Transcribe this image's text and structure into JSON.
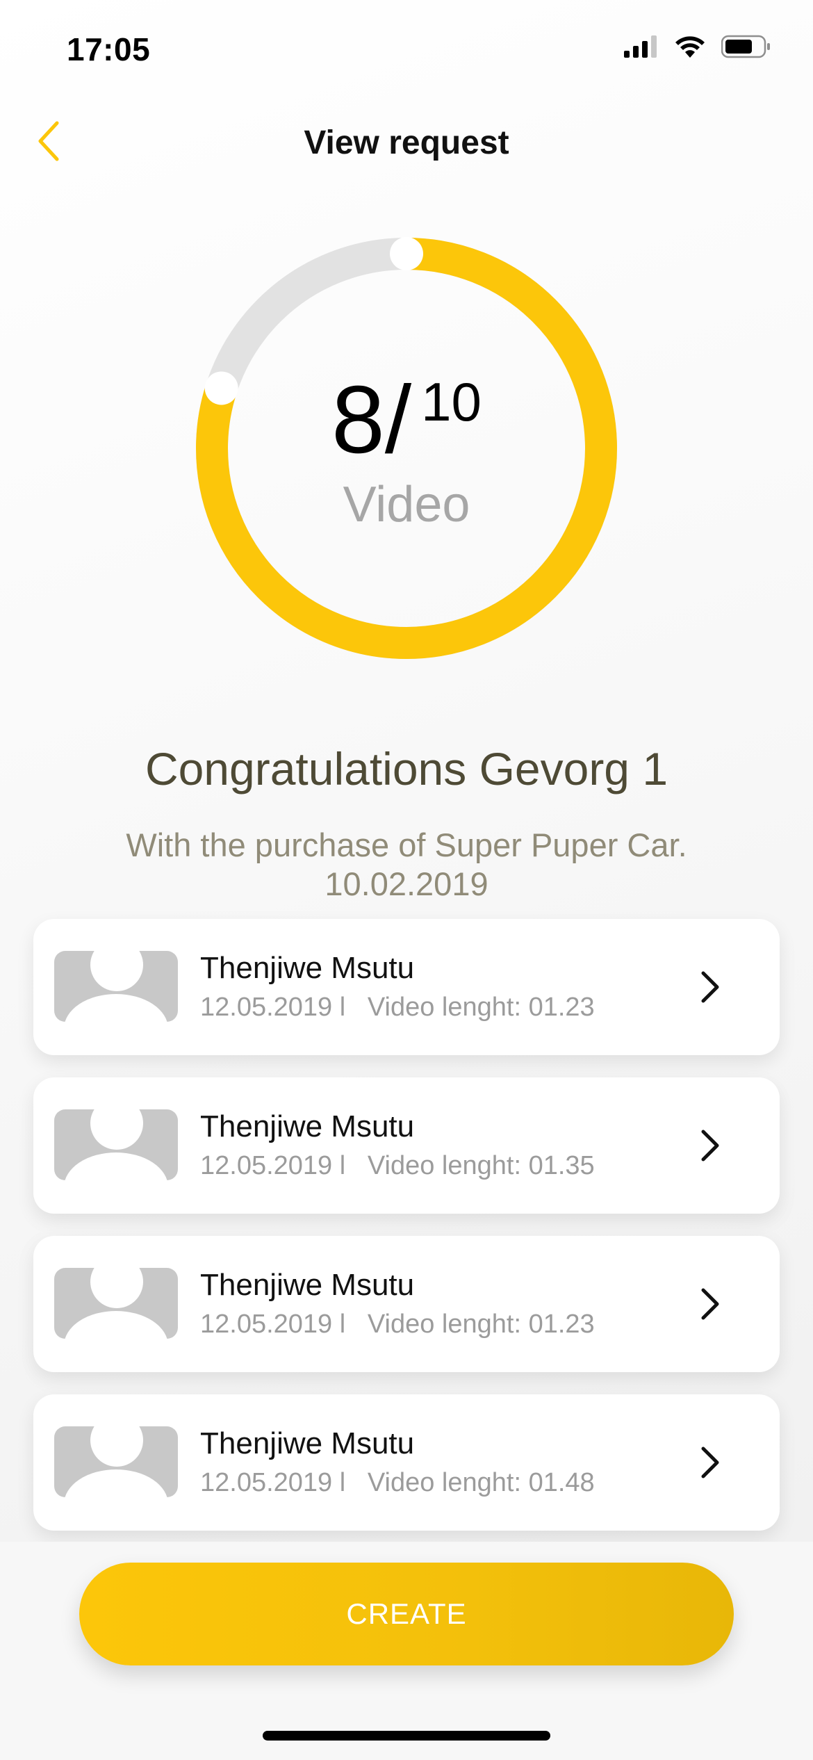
{
  "status_bar": {
    "time": "17:05"
  },
  "nav": {
    "title": "View request",
    "back_icon": "chevron-left-icon"
  },
  "progress": {
    "current": "8/",
    "total": "10",
    "unit": "Video",
    "fraction": 0.8
  },
  "congrats": {
    "title": "Congratulations Gevorg 1",
    "subtitle_line1": "With the purchase of Super Puper Car.",
    "subtitle_line2": "10.02.2019"
  },
  "videos": [
    {
      "name": "Thenjiwe Msutu",
      "meta": "12.05.2019 l   Video lenght: 01.23"
    },
    {
      "name": "Thenjiwe Msutu",
      "meta": "12.05.2019 l   Video lenght: 01.35"
    },
    {
      "name": "Thenjiwe Msutu",
      "meta": "12.05.2019 l   Video lenght: 01.23"
    },
    {
      "name": "Thenjiwe Msutu",
      "meta": "12.05.2019 l   Video lenght: 01.48"
    }
  ],
  "actions": {
    "create_label": "CREATE"
  },
  "colors": {
    "accent": "#FCC60A",
    "ring_track": "#E2E2E2",
    "title_text": "#4E4A35",
    "subtitle_text": "#908B78"
  }
}
